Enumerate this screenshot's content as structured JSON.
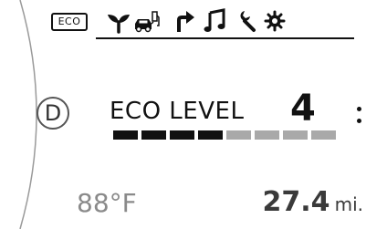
{
  "header": {
    "eco_badge": "ECO",
    "menu_icons": [
      {
        "name": "eco-plant-icon",
        "active": true
      },
      {
        "name": "fuel-vehicle-icon",
        "active": false
      },
      {
        "name": "navigation-arrow-icon",
        "active": false
      },
      {
        "name": "music-icon",
        "active": false
      },
      {
        "name": "wrench-icon",
        "active": false
      },
      {
        "name": "settings-gear-icon",
        "active": false
      }
    ]
  },
  "gear": {
    "value": "D"
  },
  "eco": {
    "label": "ECO LEVEL",
    "level": "4",
    "level_value": 4,
    "level_max": 8,
    "active_color": "#111111",
    "inactive_color": "#a9a9a9"
  },
  "footer": {
    "temperature": "88°F",
    "range_value": "27.4",
    "range_unit": "mi."
  }
}
